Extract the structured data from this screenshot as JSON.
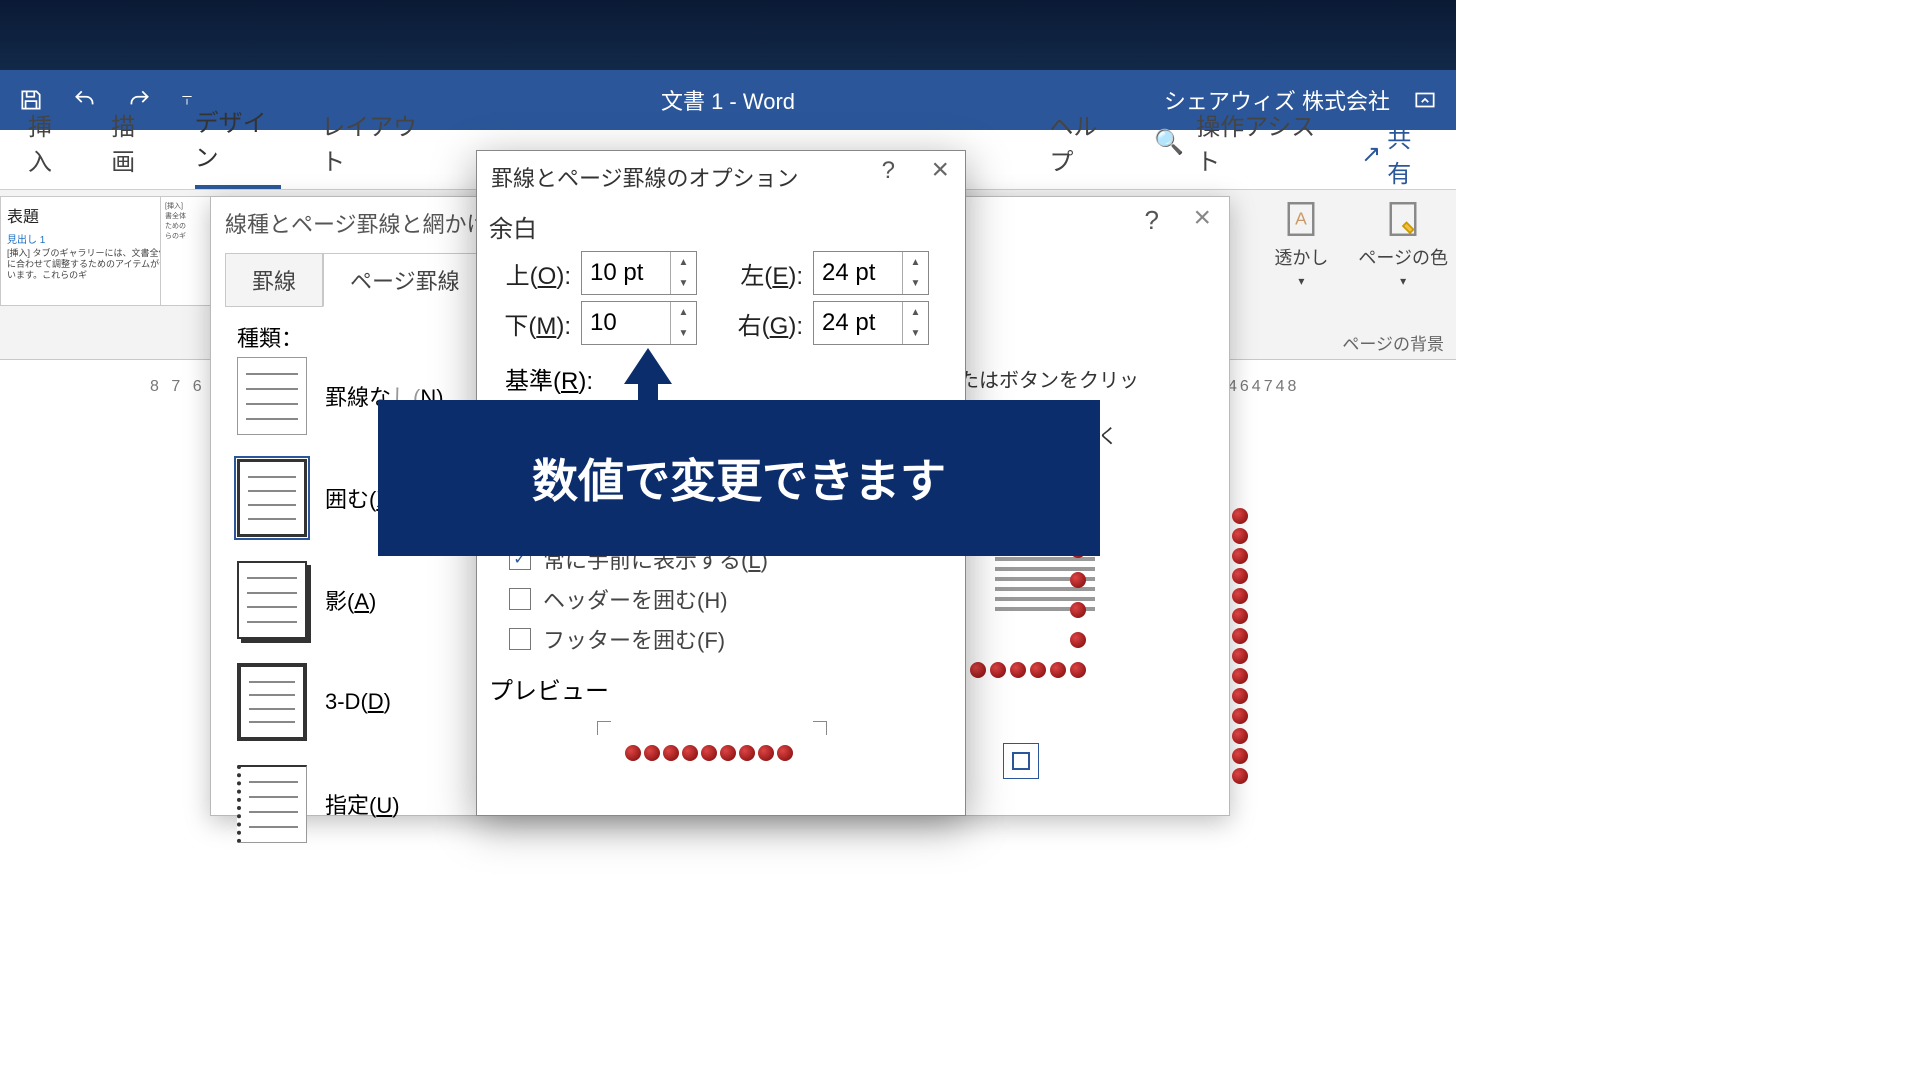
{
  "titlebar": {
    "doc": "文書 1  -  Word",
    "account": "シェアウィズ 株式会社"
  },
  "ribbon": {
    "tabs": {
      "insert": "挿入",
      "draw": "描画",
      "design": "デザイン",
      "layout": "レイアウト",
      "help": "ヘルプ",
      "tellme": "操作アシスト",
      "share": "共有"
    },
    "gallery": {
      "title": "表題",
      "sub": "見出し 1",
      "desc1": "[挿入] タブのギャラリーには、文書全体の体裁に合わせて調整するためのアイテムが含まれています。これらのギ",
      "side": "[挿入]\n書全体\nための\nらのギ"
    },
    "right": {
      "watermark": "透かし",
      "pagecolor": "ページの色",
      "group": "ページの背景"
    }
  },
  "ruler": {
    "left": "8 7 6",
    "right": "464748"
  },
  "parent_dialog": {
    "title": "線種とページ罫線と網かけの設",
    "help": "?",
    "close": "×",
    "tabs": {
      "borders": "罫線",
      "page": "ページ罫線"
    },
    "section": "種類：",
    "opts": {
      "none": "罫線なし(N)",
      "box": "囲む(X)",
      "shadow": "影(A)",
      "threeD": "3-D(D)",
      "custom": "指定(U)"
    },
    "preview_hint": "またはボタンをクリック\n　　　　　　してく"
  },
  "options_dialog": {
    "title": "罫線とページ罫線のオプション",
    "help": "?",
    "close": "×",
    "margin_label": "余白",
    "top": {
      "label": "上(O):",
      "value": "10 pt"
    },
    "bottom": {
      "label": "下(M):",
      "value": "10"
    },
    "left": {
      "label": "左(E):",
      "value": "24 pt"
    },
    "right": {
      "label": "右(G):",
      "value": "24 pt"
    },
    "basis": "基準(R):",
    "cb_front": "常に手前に表示する(L)",
    "cb_header": "ヘッダーを囲む(H)",
    "cb_footer": "フッターを囲む(F)",
    "preview": "プレビュー"
  },
  "annotation": "数値で変更できます"
}
